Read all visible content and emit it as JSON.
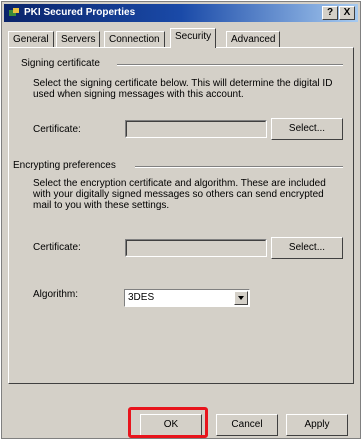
{
  "window": {
    "title": "PKI Secured Properties"
  },
  "titlebar_buttons": {
    "help": "?",
    "close": "X"
  },
  "tabs": [
    {
      "label": "General",
      "active": false
    },
    {
      "label": "Servers",
      "active": false
    },
    {
      "label": "Connection",
      "active": false
    },
    {
      "label": "Security",
      "active": true
    },
    {
      "label": "Advanced",
      "active": false
    }
  ],
  "signing": {
    "group_title": "Signing certificate",
    "description": "Select the signing certificate below. This will determine the digital ID used when signing messages with this account.",
    "certificate_label": "Certificate:",
    "certificate_value": "",
    "select_button": "Select..."
  },
  "encrypting": {
    "group_title": "Encrypting preferences",
    "description": "Select the encryption certificate and algorithm. These are included with your digitally signed messages so others can send encrypted mail to you with these settings.",
    "certificate_label": "Certificate:",
    "certificate_value": "",
    "select_button": "Select...",
    "algorithm_label": "Algorithm:",
    "algorithm_value": "3DES"
  },
  "footer": {
    "ok": "OK",
    "cancel": "Cancel",
    "apply": "Apply"
  },
  "colors": {
    "highlight": "#e8141c",
    "titlebar": "#0a246a"
  }
}
